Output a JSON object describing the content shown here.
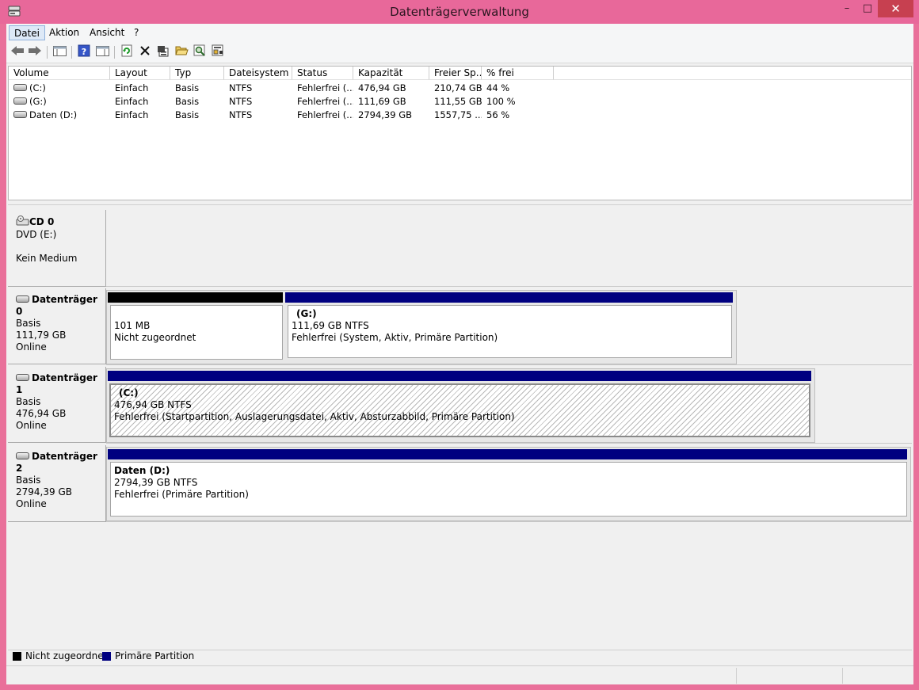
{
  "window": {
    "title": "Datenträgerverwaltung",
    "minimize": "–",
    "maximize": "□",
    "close": "✕"
  },
  "menu": [
    "Datei",
    "Aktion",
    "Ansicht",
    "?"
  ],
  "toolbar": {
    "icons": [
      "back-icon",
      "forward-icon",
      "console-tree-icon",
      "help-icon",
      "action-pane-icon",
      "refresh-icon",
      "delete-icon",
      "properties-icon",
      "open-icon",
      "search-icon",
      "export-icon"
    ]
  },
  "volume_list": {
    "columns": [
      "Volume",
      "Layout",
      "Typ",
      "Dateisystem",
      "Status",
      "Kapazität",
      "Freier Sp...",
      "% frei"
    ],
    "rows": [
      [
        "(C:)",
        "Einfach",
        "Basis",
        "NTFS",
        "Fehlerfrei (...",
        "476,94 GB",
        "210,74 GB",
        "44 %"
      ],
      [
        "(G:)",
        "Einfach",
        "Basis",
        "NTFS",
        "Fehlerfrei (...",
        "111,69 GB",
        "111,55 GB",
        "100 %"
      ],
      [
        "Daten (D:)",
        "Einfach",
        "Basis",
        "NTFS",
        "Fehlerfrei (...",
        "2794,39 GB",
        "1557,75 ...",
        "56 %"
      ]
    ]
  },
  "disks": {
    "cd0": {
      "name": "CD 0",
      "type": "DVD (E:)",
      "media": "Kein Medium"
    },
    "disk0": {
      "name": "Datenträger 0",
      "type": "Basis",
      "size": "111,79 GB",
      "state": "Online",
      "p1": {
        "size": "101 MB",
        "status": "Nicht zugeordnet"
      },
      "p2": {
        "label": "(G:)",
        "size": "111,69 GB NTFS",
        "status": "Fehlerfrei (System, Aktiv, Primäre Partition)"
      }
    },
    "disk1": {
      "name": "Datenträger 1",
      "type": "Basis",
      "size": "476,94 GB",
      "state": "Online",
      "p1": {
        "label": "(C:)",
        "size": "476,94 GB NTFS",
        "status": "Fehlerfrei (Startpartition, Auslagerungsdatei, Aktiv, Absturzabbild, Primäre Partition)"
      }
    },
    "disk2": {
      "name": "Datenträger 2",
      "type": "Basis",
      "size": "2794,39 GB",
      "state": "Online",
      "p1": {
        "label": "Daten  (D:)",
        "size": "2794,39 GB NTFS",
        "status": "Fehlerfrei (Primäre Partition)"
      }
    }
  },
  "legend": [
    {
      "label": "Nicht zugeordnet",
      "color": "#000000"
    },
    {
      "label": "Primäre Partition",
      "color": "#000080"
    }
  ]
}
